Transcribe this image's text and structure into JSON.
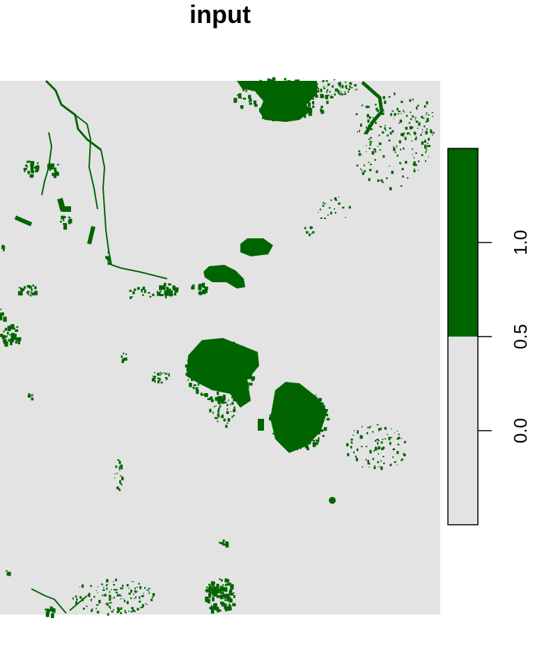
{
  "chart_data": {
    "type": "heatmap",
    "title": "input",
    "xlabel": "",
    "ylabel": "",
    "legend": {
      "placement": "right",
      "classes": [
        {
          "range": [
            -0.5,
            0.5
          ],
          "color": "#E3E3E3",
          "label": "0"
        },
        {
          "range": [
            0.5,
            1.5
          ],
          "color": "#006400",
          "label": "1"
        }
      ],
      "range": [
        -0.5,
        1.5
      ],
      "ticks": [
        0.0,
        0.5,
        1.0
      ],
      "tick_labels": [
        "0.0",
        "0.5",
        "1.0"
      ]
    },
    "raster": {
      "values_present": [
        0,
        1
      ],
      "background_value": 0,
      "background_color": "#E3E3E3",
      "foreground_value": 1,
      "foreground_color": "#006400",
      "description": "Binary raster: mostly 0 with scattered patches of 1 (large clusters near top-center, center, center-right, and bottom-center; linear river-like features on the left)"
    }
  }
}
